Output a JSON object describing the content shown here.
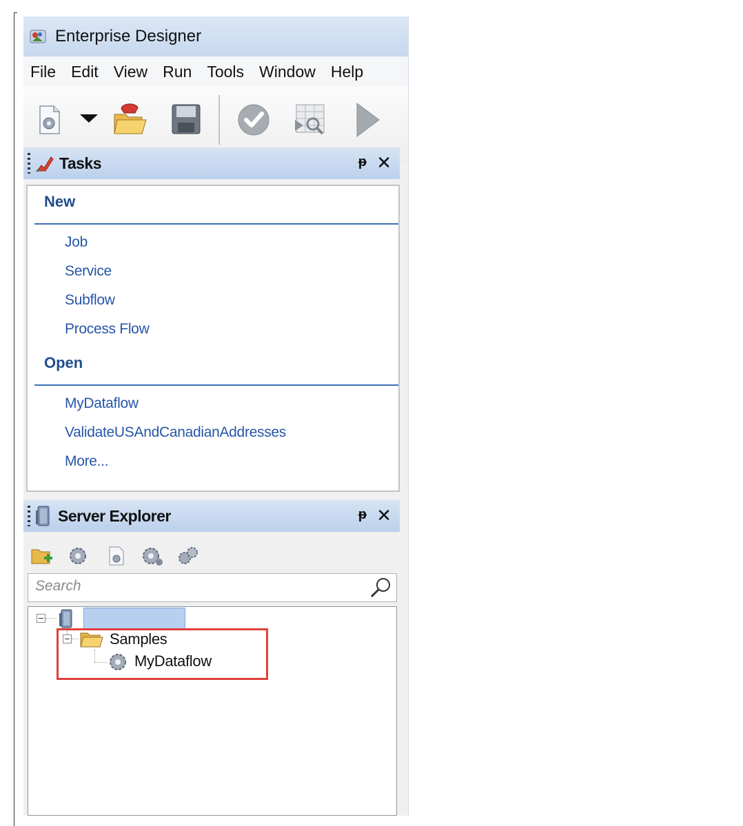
{
  "window": {
    "title": "Enterprise Designer"
  },
  "menu": [
    "File",
    "Edit",
    "View",
    "Run",
    "Tools",
    "Window",
    "Help"
  ],
  "toolbar": {
    "icons": [
      "new-dataflow-icon",
      "dropdown-arrow-icon",
      "open-folder-icon",
      "save-icon",
      "validate-icon",
      "inspect-icon",
      "run-icon"
    ]
  },
  "tasks_panel": {
    "title": "Tasks",
    "pin_glyph": "ᵽ",
    "close_glyph": "✕",
    "new_section": {
      "title": "New",
      "items": [
        "Job",
        "Service",
        "Subflow",
        "Process Flow"
      ]
    },
    "open_section": {
      "title": "Open",
      "items": [
        "MyDataflow",
        "ValidateUSAndCanadianAddresses",
        "More..."
      ]
    }
  },
  "server_explorer": {
    "title": "Server Explorer",
    "pin_glyph": "ᵽ",
    "close_glyph": "✕",
    "toolbar_icons": [
      "new-folder-icon",
      "job-icon",
      "service-icon",
      "subflow-icon",
      "process-flow-icon"
    ],
    "search": {
      "placeholder": "Search",
      "value": ""
    },
    "tree": {
      "server_name": "",
      "folder": "Samples",
      "child": "MyDataflow"
    }
  },
  "colors": {
    "link": "#2656a8",
    "section_heading": "#1f4e8c",
    "panel_header": "#bcd0ec",
    "highlight_border": "#e0403c"
  }
}
